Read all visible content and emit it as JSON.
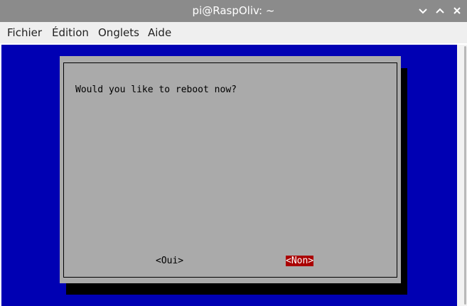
{
  "window": {
    "title": "pi@RaspOliv: ~",
    "controls": [
      "minimize",
      "maximize",
      "close"
    ]
  },
  "menu": {
    "items": [
      "Fichier",
      "Édition",
      "Onglets",
      "Aide"
    ]
  },
  "dialog": {
    "message": "Would you like to reboot now?",
    "buttons": {
      "yes": "<Oui>",
      "no": "<Non>"
    },
    "selected": "no"
  },
  "colors": {
    "titlebar": "#8b8b8b",
    "terminal_bg": "#0000b3",
    "dialog_bg": "#aaaaaa",
    "selected_button": "#aa0000"
  }
}
